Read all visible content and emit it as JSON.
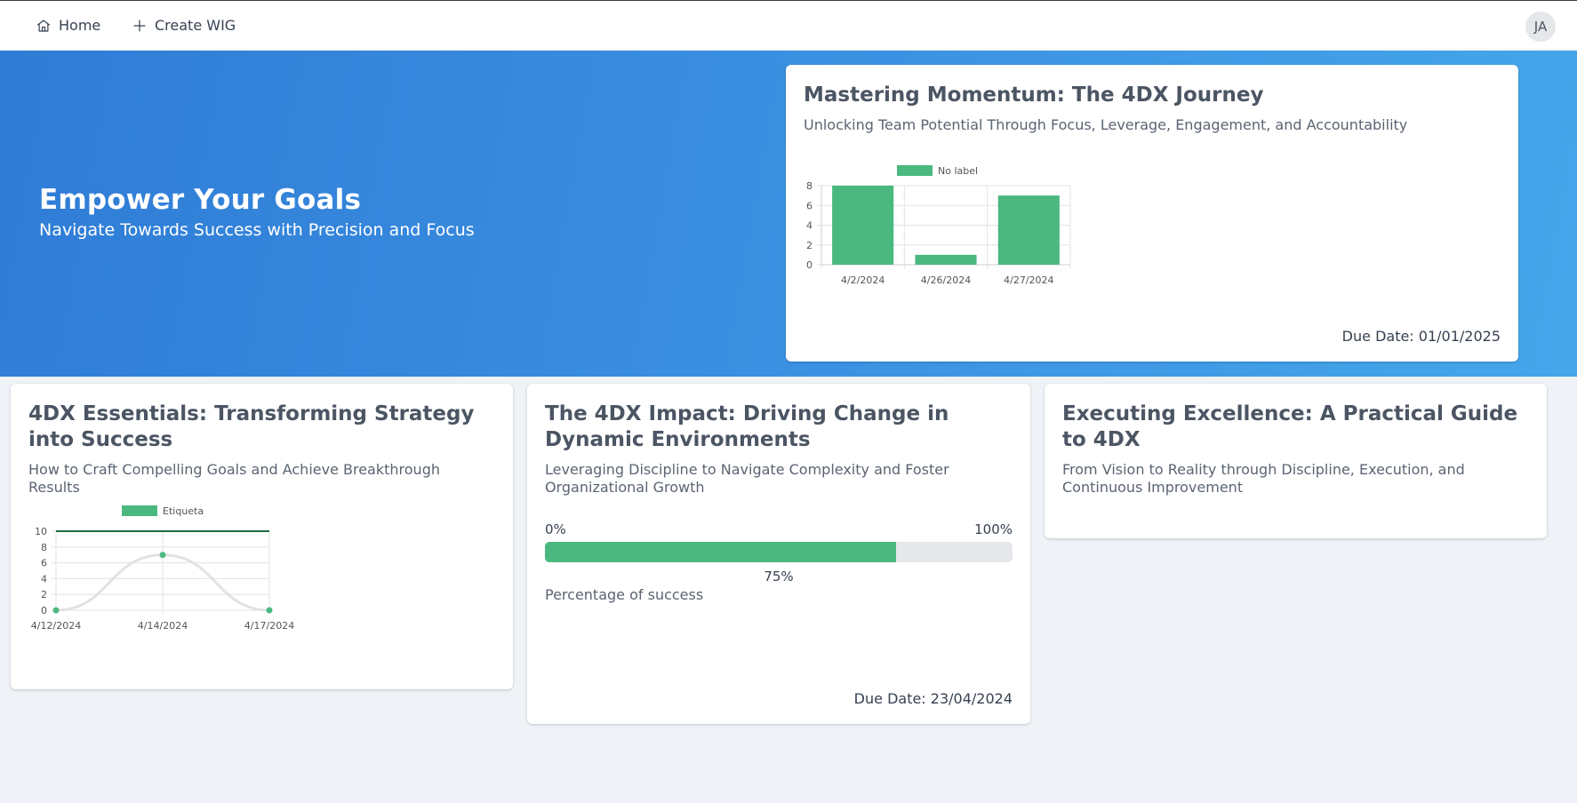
{
  "nav": {
    "home_label": "Home",
    "create_label": "Create WIG",
    "avatar_initials": "JA"
  },
  "hero": {
    "title": "Empower Your Goals",
    "subtitle": "Navigate Towards Success with Precision and Focus"
  },
  "colors": {
    "accent_green": "#4ab87f",
    "hero_blue": "#3a8ee0"
  },
  "cards": {
    "momentum": {
      "title": "Mastering Momentum: The 4DX Journey",
      "description": "Unlocking Team Potential Through Focus, Leverage, Engagement, and Accountability",
      "due_date": "Due Date: 01/01/2025"
    },
    "essentials": {
      "title": "4DX Essentials: Transforming Strategy into Success",
      "description": "How to Craft Compelling Goals and Achieve Breakthrough Results"
    },
    "impact": {
      "title": "The 4DX Impact: Driving Change in Dynamic Environments",
      "description": "Leveraging Discipline to Navigate Complexity and Foster Organizational Growth",
      "progress_min": "0%",
      "progress_max": "100%",
      "progress_value": 75,
      "progress_label": "75%",
      "progress_caption": "Percentage of success",
      "due_date": "Due Date: 23/04/2024"
    },
    "excellence": {
      "title": "Executing Excellence: A Practical Guide to 4DX",
      "description": "From Vision to Reality through Discipline, Execution, and Continuous Improvement"
    }
  },
  "chart_data": [
    {
      "type": "bar",
      "categories": [
        "4/2/2024",
        "4/26/2024",
        "4/27/2024"
      ],
      "series": [
        {
          "name": "No label",
          "values": [
            8,
            1,
            7
          ]
        }
      ],
      "ylim": [
        0,
        8
      ],
      "yticks": [
        0,
        2,
        4,
        6,
        8
      ],
      "legend": "top",
      "grid": true
    },
    {
      "type": "line",
      "categories": [
        "4/12/2024",
        "4/14/2024",
        "4/17/2024"
      ],
      "series": [
        {
          "name": "Etiqueta",
          "values": [
            0,
            7,
            0
          ]
        }
      ],
      "target": 10,
      "ylim": [
        0,
        10
      ],
      "yticks": [
        0,
        2,
        4,
        6,
        8,
        10
      ],
      "legend": "top",
      "grid": true
    }
  ]
}
